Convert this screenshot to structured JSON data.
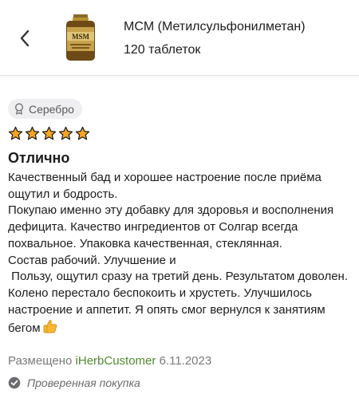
{
  "header": {
    "back_icon": "chevron-left-icon",
    "product_name": "MCM (Метилсульфонилметан)",
    "product_count": "120 таблеток",
    "product_image_label": "MSM"
  },
  "review": {
    "badge": "Серебро",
    "badge_icon": "medal-icon",
    "rating": 5,
    "rating_max": 5,
    "star_color": "#f5a623",
    "title": "Отлично",
    "body": "Качественный бад и хорошее настроение после приёма ощутил и бодрость.\nПокупаю именно эту добавку для здоровья и восполнения дефицита. Качество ингредиентов от Солгар всегда похвальное. Упаковка качественная, стеклянная.\nСостав рабочий. Улучшение и\n Пользу, ощутил сразу на третий день. Результатом доволен. Колено перестало беспокоить и хрустеть. Улучшилось настроение и аппетит. Я опять смог вернулся к занятиям бегом",
    "body_end_icon": "thumbs-up-icon",
    "posted_prefix": "Размещено",
    "author": "iHerbCustomer",
    "date": "6.11.2023",
    "author_color": "#4f8a2f",
    "verified_label": "Проверенная покупка",
    "verified_icon": "check-circle-icon"
  }
}
